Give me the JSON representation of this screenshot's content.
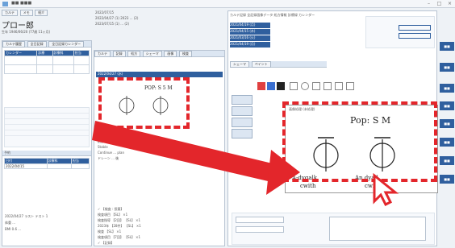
{
  "window": {
    "title": "■■ ■■■"
  },
  "patient": {
    "name": "プロー郎",
    "dob": "生年 1946/06/20 (77歳 11ヶ月)",
    "line1": "2022/07/15",
    "line2": "2022/04/27 (1) 2023 ... (2)",
    "line3": "2023/07/15 (1) ... (2)"
  },
  "toolbar_tabs": [
    "カルテ",
    "メモ",
    "紹介",
    "診療",
    "ワークシート"
  ],
  "left": {
    "tabs": [
      "カルテ履歴",
      "全日記録",
      "全日記録カレンダー"
    ],
    "table_headers": [
      "カレンダー",
      "診療",
      "診療科",
      "担当"
    ],
    "section_header": "予約",
    "rows2_headers": [
      "日付",
      "診療科",
      "担当"
    ],
    "date": "2022/04/15",
    "footer1": "2022/04/27 ラスト テスト 1",
    "footer2": "体重 ...",
    "footer3": "BMI 0.6 ..."
  },
  "center": {
    "tabs": [
      "カルテ",
      "記録",
      "処方",
      "シェーマ",
      "画像",
      "検査",
      "検査",
      "紹介"
    ],
    "entry_date": "2022/04/27 (水)",
    "drawing_text": "POP: S 5 M",
    "notes": [
      "【経過】",
      "創部清潔",
      "Stable",
      "Continue ... plan",
      "ドレーン ... 後"
    ],
    "bottom_header": "✓ 【検査 : 投薬】",
    "items": [
      "検査項目 【SL】 ×1",
      "検査指導 【2回】 【SL】 ×1",
      "2023年 【28件】 【SL】 ×1",
      "検査 【SL】 ×1",
      "検査項目 【7回】 【SL】 ×1"
    ],
    "footer": "✓ 【記録】"
  },
  "right": {
    "header": "カルテ記録 全記録画像データ 処方情報 診療録 カレンダー",
    "dates": [
      "2021/04/19 (月)",
      "2021/04/15 (木)",
      "2021/03/16 (火)",
      "2021/04/19 (月)"
    ],
    "editor_tabs": [
      "シェーマ",
      "ペイント"
    ],
    "canvas_title": "画像処理 (未処理)",
    "canvas_text": "Pop: S M",
    "labels": [
      "A-dygalk",
      "An dyall",
      "cwith",
      "cwith"
    ]
  },
  "sidebar": {
    "buttons": [
      "■■",
      "■■",
      "■■",
      "■■",
      "■■",
      "■■",
      "■■",
      "■■"
    ]
  },
  "colors": {
    "accent": "#2f5f9e",
    "highlight": "#e3262b"
  }
}
